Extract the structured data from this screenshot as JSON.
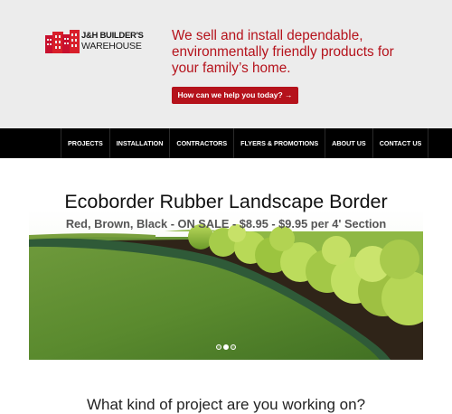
{
  "brand": {
    "line1": "J&H BUILDER'S",
    "line2": "WAREHOUSE",
    "accent_color": "#b5121b"
  },
  "header": {
    "tagline": "We sell and install dependable, environmentally friendly products for your family’s home.",
    "cta_label": "How can we help you today? →"
  },
  "nav": {
    "items": [
      {
        "label": "PROJECTS"
      },
      {
        "label": "INSTALLATION"
      },
      {
        "label": "CONTRACTORS"
      },
      {
        "label": "FLYERS & PROMOTIONS"
      },
      {
        "label": "ABOUT US"
      },
      {
        "label": "CONTACT US"
      }
    ]
  },
  "hero": {
    "title": "Ecoborder Rubber Landscape Border",
    "subtitle": "Red, Brown, Black - ON SALE - $8.95 - $9.95 per 4' Section",
    "slide_count": 3,
    "active_slide": 1,
    "image": "garden-lawn-border-photo"
  },
  "section": {
    "question": "What kind of project are you working on?"
  }
}
